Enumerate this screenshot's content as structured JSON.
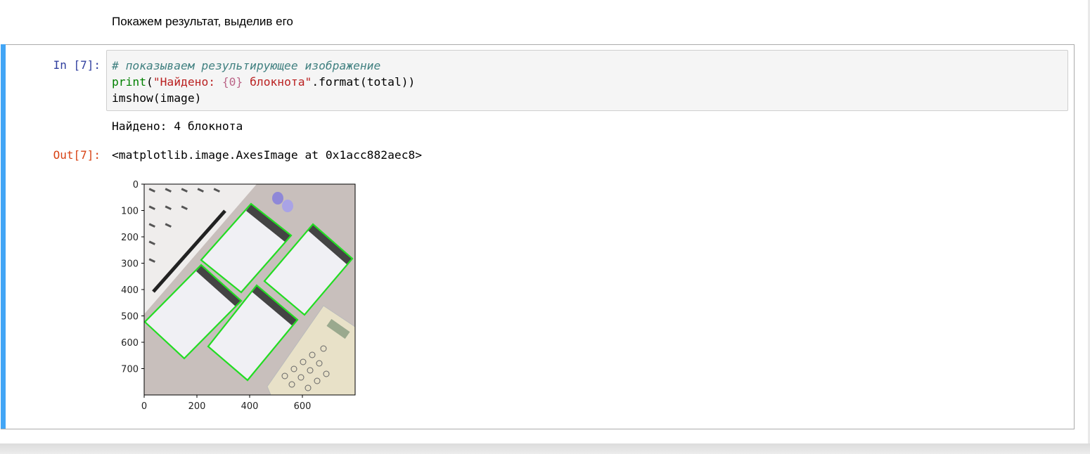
{
  "markdown": {
    "text": "Покажем результат, выделив его"
  },
  "cell": {
    "in_prompt": "In [7]:",
    "out_prompt": "Out[7]:",
    "code": {
      "line1": "# показываем результирующее изображение",
      "line2_func": "print",
      "line2_open": "(",
      "line2_str_a": "\"Найдено: ",
      "line2_interp": "{0}",
      "line2_str_b": " блокнота\"",
      "line2_rest": ".format(total))",
      "line3": "imshow(image)"
    },
    "stream_output": "Найдено: 4 блокнота",
    "result_output": "<matplotlib.image.AxesImage at 0x1acc882aec8>"
  },
  "plot": {
    "y_ticks": [
      "0",
      "100",
      "200",
      "300",
      "400",
      "500",
      "600",
      "700"
    ],
    "x_ticks": [
      "0",
      "200",
      "400",
      "600"
    ],
    "detection_color": "#22dd22",
    "background_color": "#c8bfbc"
  }
}
